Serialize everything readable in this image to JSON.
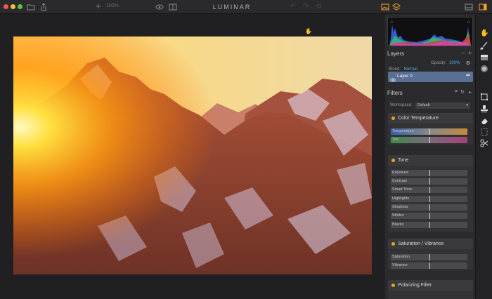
{
  "window": {
    "title": "LUMINAR",
    "zoom": "100%"
  },
  "colors": {
    "accent": "#f0a028",
    "layer_selected": "#5a6f94",
    "blend_value": "#4ab3e0"
  },
  "toolbar_icons": [
    "folder-icon",
    "share-icon",
    "zoom-in-icon",
    "eye-icon",
    "compare-icon",
    "undo-icon",
    "redo-icon",
    "history-icon",
    "photo-view-icon",
    "layers-view-icon",
    "single-panel-icon",
    "sidebar-icon"
  ],
  "layers": {
    "title": "Layers",
    "blend_label": "Blend:",
    "blend_value": "Normal",
    "opacity_label": "Opacity:",
    "opacity_value": "100%",
    "items": [
      {
        "name": "Layer 0"
      }
    ]
  },
  "filters": {
    "title": "Filters",
    "workspace_label": "Workspace:",
    "workspace_value": "Default",
    "cards": [
      {
        "name": "Color Temperature",
        "sliders": [
          "Temperature",
          "Tint"
        ]
      },
      {
        "name": "Tone",
        "sliders": [
          "Exposure",
          "Contrast",
          "Smart Tone",
          "Highlights",
          "Shadows",
          "Whites",
          "Blacks"
        ]
      },
      {
        "name": "Saturation / Vibrance",
        "sliders": [
          "Saturation",
          "Vibrance"
        ]
      },
      {
        "name": "Polarizing Filter",
        "sliders": []
      }
    ]
  }
}
